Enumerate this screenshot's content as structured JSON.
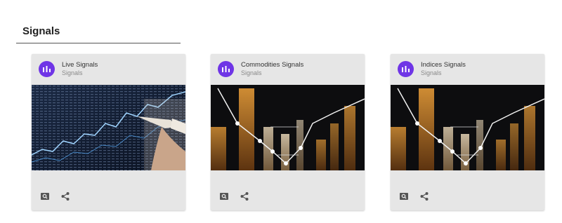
{
  "section": {
    "title": "Signals"
  },
  "cards": [
    {
      "title": "Live Signals",
      "subtitle": "Signals",
      "avatar_icon": "bar-chart-icon",
      "image": "stock-screen-with-pen"
    },
    {
      "title": "Commodities Signals",
      "subtitle": "Signals",
      "avatar_icon": "bar-chart-icon",
      "image": "orange-bar-chart-graphic"
    },
    {
      "title": "Indices Signals",
      "subtitle": "Signals",
      "avatar_icon": "bar-chart-icon",
      "image": "orange-bar-chart-graphic"
    }
  ],
  "actions": {
    "zoom_icon": "zoom-icon",
    "share_icon": "share-icon"
  },
  "colors": {
    "avatar": "#6f35e6",
    "card_bg": "#e6e6e6",
    "icon": "#555555"
  }
}
